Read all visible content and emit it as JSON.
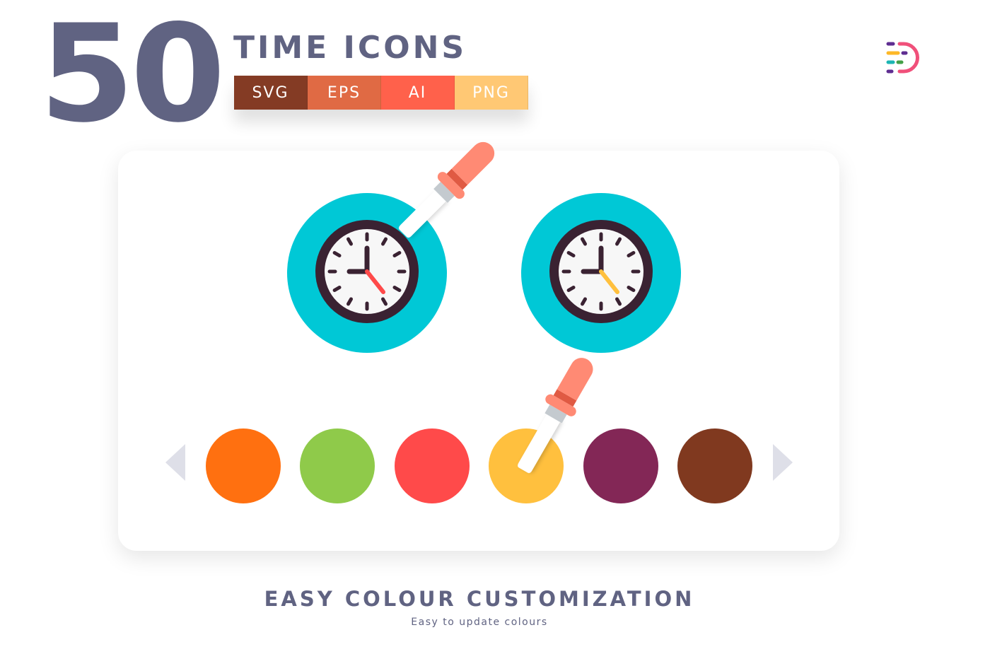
{
  "header": {
    "count": "50",
    "title": "TIME ICONS",
    "formats": [
      {
        "label": "SVG",
        "color": "#843B24"
      },
      {
        "label": "EPS",
        "color": "#E06A44"
      },
      {
        "label": "AI",
        "color": "#FF614B"
      },
      {
        "label": "PNG",
        "color": "#FFC874"
      }
    ]
  },
  "preview": {
    "icons": [
      {
        "name": "clock",
        "background": "#00C8D6",
        "rim": "#3A2232",
        "face": "#F7F7F7",
        "hand_accent": "#FF4A4A"
      },
      {
        "name": "clock",
        "background": "#00C8D6",
        "rim": "#3A2232",
        "face": "#F7F7F7",
        "hand_accent": "#FFC03E"
      }
    ],
    "swatches": [
      "#FF7010",
      "#8FCA4A",
      "#FF4A4A",
      "#FFC03E",
      "#832756",
      "#80391F"
    ],
    "dropper_color": "#FF8A74"
  },
  "footer": {
    "title": "EASY COLOUR CUSTOMIZATION",
    "subtitle": "Easy to update colours"
  }
}
